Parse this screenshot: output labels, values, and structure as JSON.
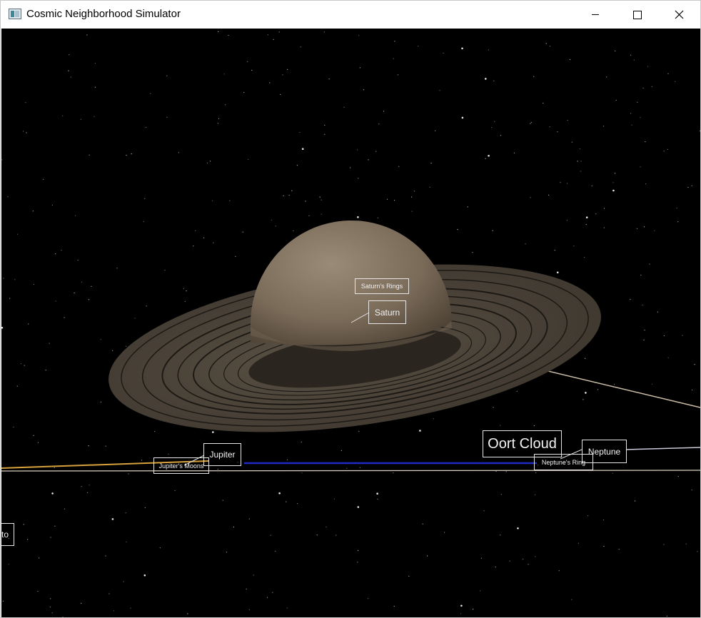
{
  "window": {
    "title": "Cosmic Neighborhood Simulator",
    "icon": "app-window-icon",
    "controls": [
      "minimize-icon",
      "maximize-icon",
      "close-icon"
    ]
  },
  "scene": {
    "background_color": "#000000",
    "labels": {
      "saturns_rings": "Saturn's Rings",
      "saturn": "Saturn",
      "jupiter": "Jupiter",
      "jupiters_moons": "Jupiter's Moons",
      "oort_cloud": "Oort Cloud",
      "neptune": "Neptune",
      "neptunes_rings": "Neptune's Ring",
      "pluto_partial": "to"
    },
    "colors": {
      "saturn_body": "#7a6a58",
      "saturn_rings": "#4a4237",
      "orbit_jupiter": "#d6a13c",
      "orbit_neptune_segment": "#1f2bc9",
      "orbit_main": "#d8d0c0",
      "label_border": "#e6e6e6"
    }
  }
}
